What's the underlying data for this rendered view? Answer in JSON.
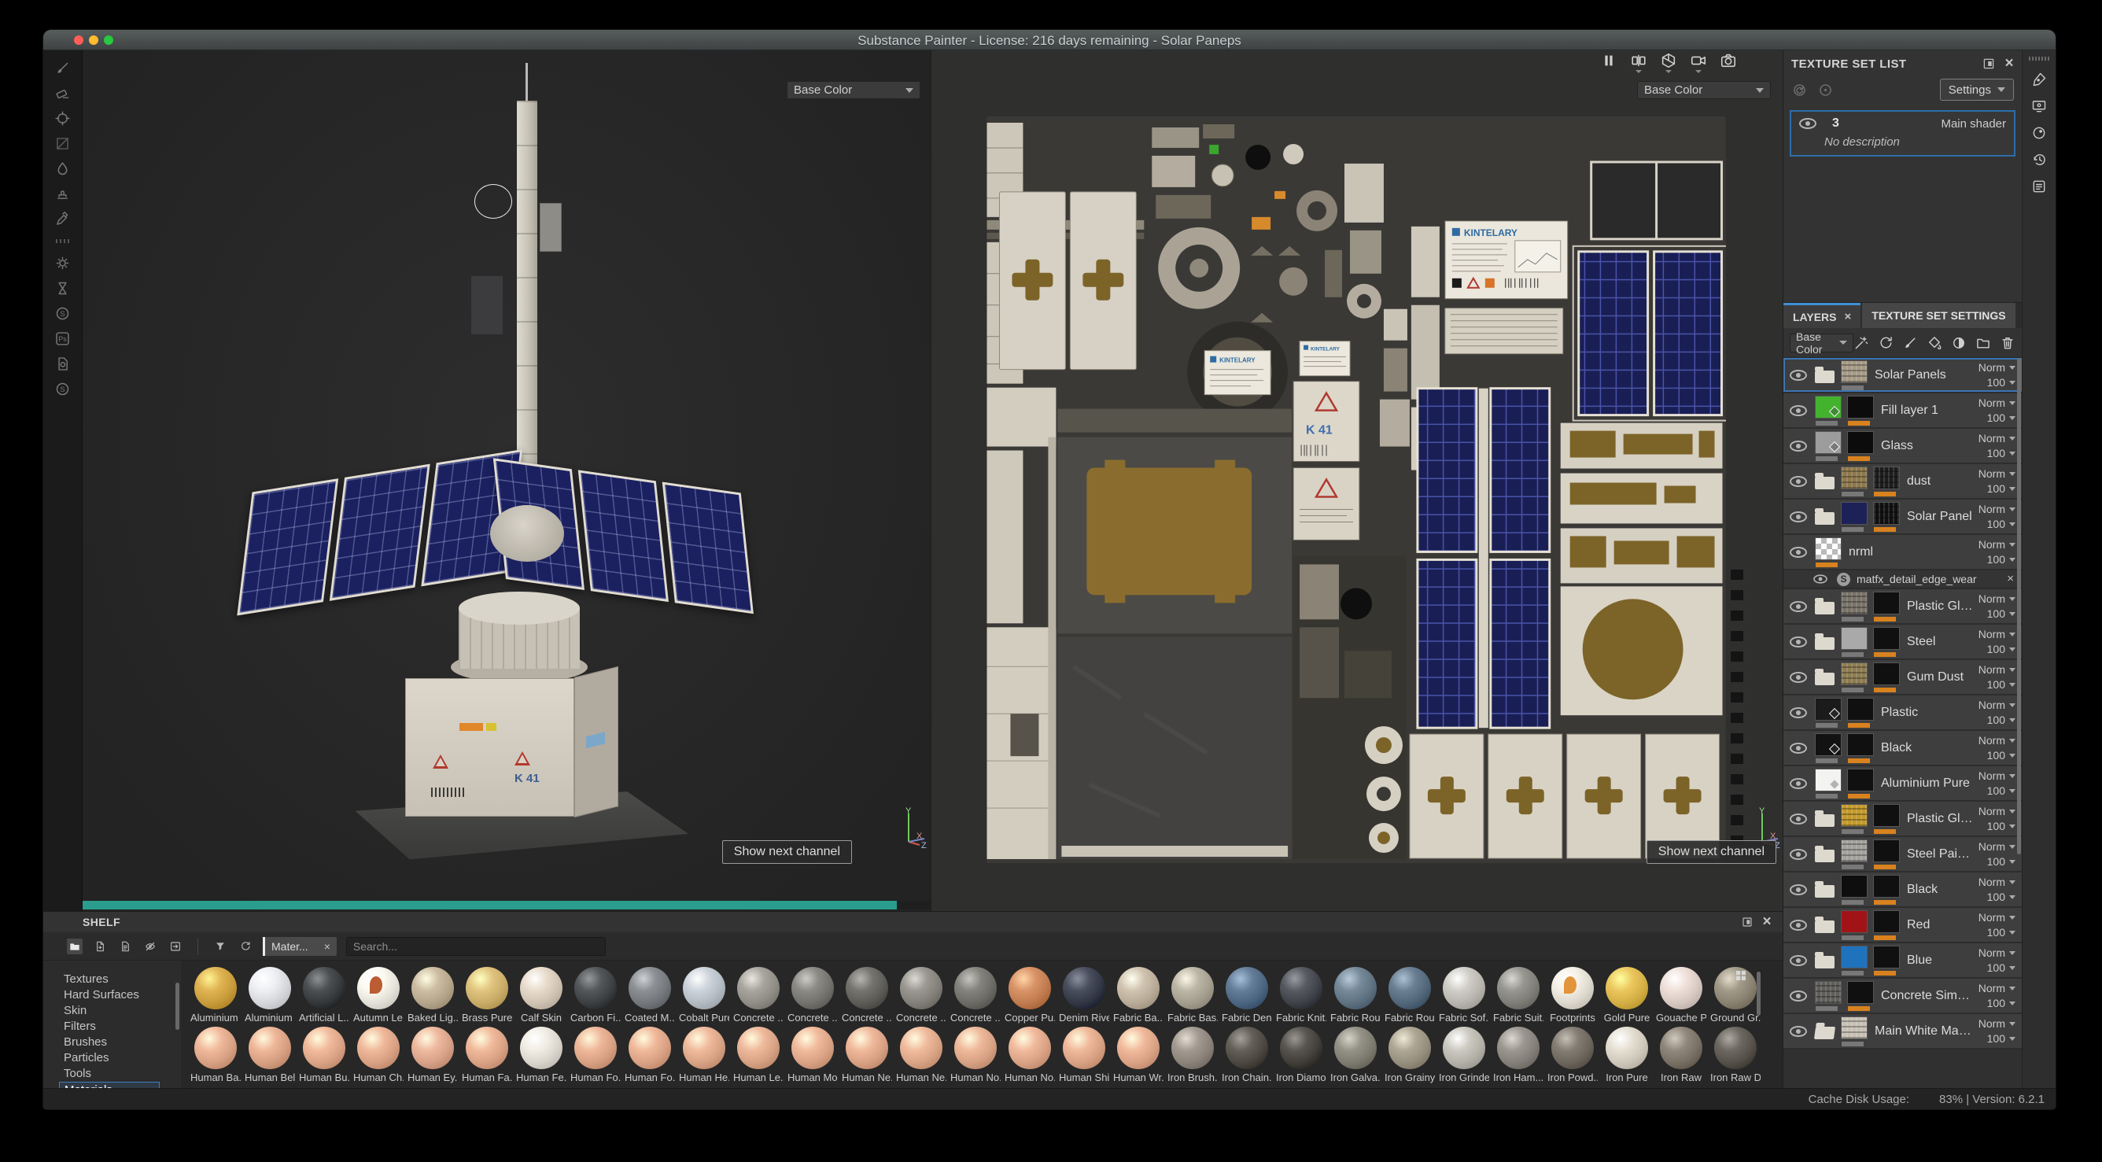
{
  "window": {
    "title": "Substance Painter - License: 216 days remaining - Solar Paneps"
  },
  "top_toolbar": {
    "icons": [
      "pause",
      "view-toggle",
      "geometry",
      "camera-video",
      "camera-photo"
    ]
  },
  "left_toolbar": {
    "icons": [
      "paint-brush",
      "eraser",
      "projection",
      "polygon-fill",
      "smudge",
      "clone-stamp",
      "color-picker",
      "dynamic-gear",
      "hourglass",
      "substance-badge",
      "photoshop",
      "iray",
      "substance-source"
    ]
  },
  "right_strip": {
    "icons": [
      "texture-pen",
      "display-settings",
      "shader-settings",
      "history",
      "log"
    ]
  },
  "viewport3d": {
    "channel": "Base Color",
    "show_next_channel": "Show next channel",
    "axes": [
      "Y",
      "X",
      "Z"
    ],
    "base_label": "K 41"
  },
  "viewport2d": {
    "channel": "Base Color",
    "show_next_channel": "Show next channel",
    "axes": [
      "Y",
      "X",
      "Z"
    ],
    "texture_brand": "KINTELARY",
    "texture_label": "K 41"
  },
  "texture_set_list": {
    "title": "TEXTURE SET LIST",
    "icons": [
      "tsl-sync",
      "tsl-solo"
    ],
    "settings_button": "Settings",
    "item": {
      "name": "3",
      "shader": "Main shader",
      "description": "No description"
    }
  },
  "layers_panel": {
    "tabs": [
      {
        "label": "LAYERS"
      },
      {
        "label": "TEXTURE SET SETTINGS"
      }
    ],
    "channel": "Base Color",
    "toolbar_icons": [
      "add-effect",
      "add-smart-material",
      "add-paint-layer",
      "add-fill-layer",
      "add-smart-mask",
      "add-folder",
      "delete"
    ],
    "layers": [
      {
        "name": "Solar Panels",
        "blend": "Norm",
        "opacity": "100",
        "folder": true,
        "thumb": "tex:#a59a86",
        "mask": null,
        "bar1": "gray",
        "bar2": null,
        "selected": true
      },
      {
        "name": "Fill layer 1",
        "blend": "Norm",
        "opacity": "100",
        "thumb": "fill:#43b32e",
        "mask": "flat:#0c0c0c",
        "bar1": "gray",
        "bar2": "orange"
      },
      {
        "name": "Glass",
        "blend": "Norm",
        "opacity": "100",
        "thumb": "fill:#9c9c9c",
        "mask": "flat:#0c0c0c",
        "bar1": "gray",
        "bar2": "orange"
      },
      {
        "name": "dust",
        "blend": "Norm",
        "opacity": "100",
        "folder": true,
        "thumb": "tex:#8d784c",
        "mask": "tex:#1d1d1d",
        "bar1": "gray",
        "bar2": "orange"
      },
      {
        "name": "Solar Panel",
        "blend": "Norm",
        "opacity": "100",
        "folder": true,
        "thumb": "flat:#1c2158",
        "mask": "tex:#111111",
        "bar1": "gray",
        "bar2": "orange"
      },
      {
        "name": "nrml",
        "blend": "Norm",
        "opacity": "100",
        "thumb": "checker",
        "mask": null,
        "bar1": "orange",
        "bar2": null
      },
      {
        "effect": "matfx_detail_edge_wear"
      },
      {
        "name": "Plastic Glossy Stained",
        "blend": "Norm",
        "opacity": "100",
        "folder": true,
        "thumb": "tex:#787268",
        "mask": "flat:#101010",
        "bar1": "gray",
        "bar2": "orange"
      },
      {
        "name": "Steel",
        "blend": "Norm",
        "opacity": "100",
        "folder": true,
        "thumb": "flat:#a9a9a9",
        "mask": "flat:#101010",
        "bar1": "gray",
        "bar2": "orange"
      },
      {
        "name": "Gum Dust",
        "blend": "Norm",
        "opacity": "100",
        "folder": true,
        "thumb": "tex:#8d7c52",
        "mask": "flat:#101010",
        "bar1": "gray",
        "bar2": "orange"
      },
      {
        "name": "Plastic",
        "blend": "Norm",
        "opacity": "100",
        "thumb": "fill:#1b1b1b",
        "mask": "flat:#101010",
        "bar1": "gray",
        "bar2": "orange"
      },
      {
        "name": "Black",
        "blend": "Norm",
        "opacity": "100",
        "thumb": "fill:#121212",
        "mask": "flat:#101010",
        "bar1": "gray",
        "bar2": "orange"
      },
      {
        "name": "Aluminium Pure",
        "blend": "Norm",
        "opacity": "100",
        "thumb": "fill:#f3f3f1",
        "mask": "flat:#101010",
        "bar1": "gray",
        "bar2": "orange"
      },
      {
        "name": "Plastic Glossy Stained",
        "blend": "Norm",
        "opacity": "100",
        "folder": true,
        "thumb": "tex:#c2992b",
        "mask": "flat:#101010",
        "bar1": "gray",
        "bar2": "orange"
      },
      {
        "name": "Steel Painted Rough D...",
        "blend": "Norm",
        "opacity": "100",
        "folder": true,
        "thumb": "tex:#a3a19c",
        "mask": "flat:#101010",
        "bar1": "gray",
        "bar2": "orange"
      },
      {
        "name": "Black",
        "blend": "Norm",
        "opacity": "100",
        "folder": true,
        "thumb": "flat:#0e0e0e",
        "mask": "flat:#101010",
        "bar1": "gray",
        "bar2": "orange"
      },
      {
        "name": "Red",
        "blend": "Norm",
        "opacity": "100",
        "folder": true,
        "thumb": "flat:#a21317",
        "mask": "flat:#101010",
        "bar1": "gray",
        "bar2": "orange"
      },
      {
        "name": "Blue",
        "blend": "Norm",
        "opacity": "100",
        "folder": true,
        "thumb": "flat:#1f73bd",
        "mask": "flat:#101010",
        "bar1": "gray",
        "bar2": "orange"
      },
      {
        "name": "Concrete Simple",
        "blend": "Norm",
        "opacity": "100",
        "thumb": "tex:#5f5e5a",
        "mask": "flat:#101010",
        "bar1": "gray",
        "bar2": "orange"
      },
      {
        "name": "Main White Material",
        "blend": "Norm",
        "opacity": "100",
        "folderOpen": true,
        "thumb": "tex:#c7c0b4",
        "mask": null,
        "bar1": "gray",
        "bar2": null
      }
    ]
  },
  "shelf": {
    "title": "SHELF",
    "toolbar_icons": [
      "folder-fill",
      "new-resource",
      "import-resources",
      "hidden",
      "export"
    ],
    "filter_icons": [
      "filter",
      "refresh"
    ],
    "tab_label": "Mater...",
    "search_placeholder": "Search...",
    "categories": [
      "Textures",
      "Hard Surfaces",
      "Skin",
      "Filters",
      "Brushes",
      "Particles",
      "Tools",
      "Materials"
    ],
    "selected_category": "Materials",
    "materials_row1": [
      {
        "label": "Aluminium ...",
        "color": "#c79a3a"
      },
      {
        "label": "Aluminium ...",
        "color": "#d4d6da"
      },
      {
        "label": "Artificial L...",
        "color": "#33373a"
      },
      {
        "label": "Autumn Le...",
        "color": "#e3e0d8",
        "accent": "#b44a1e"
      },
      {
        "label": "Baked Lig...",
        "color": "#b4a48a"
      },
      {
        "label": "Brass Pure",
        "color": "#c8ab66"
      },
      {
        "label": "Calf Skin",
        "color": "#cfc2b2"
      },
      {
        "label": "Carbon Fi...",
        "color": "#3c3f42"
      },
      {
        "label": "Coated M...",
        "color": "#73777b"
      },
      {
        "label": "Cobalt Pure",
        "color": "#b3bac1"
      },
      {
        "label": "Concrete ...",
        "color": "#8f8c85"
      },
      {
        "label": "Concrete ...",
        "color": "#73716b"
      },
      {
        "label": "Concrete ...",
        "color": "#5d5b56"
      },
      {
        "label": "Concrete ...",
        "color": "#817f78"
      },
      {
        "label": "Concrete ...",
        "color": "#6c6a64"
      },
      {
        "label": "Copper Pu...",
        "color": "#bf7a4e"
      },
      {
        "label": "Denim Rivet",
        "color": "#303644"
      },
      {
        "label": "Fabric Ba...",
        "color": "#b7ab97"
      },
      {
        "label": "Fabric Bas...",
        "color": "#a39d8e"
      },
      {
        "label": "Fabric Den...",
        "color": "#4b647f"
      },
      {
        "label": "Fabric Knit...",
        "color": "#3e4147"
      },
      {
        "label": "Fabric Rou...",
        "color": "#5e7181"
      },
      {
        "label": "Fabric Rou...",
        "color": "#52667a"
      },
      {
        "label": "Fabric Sof...",
        "color": "#b6b4ad"
      },
      {
        "label": "Fabric Suit...",
        "color": "#7f7d77"
      },
      {
        "label": "Footprints",
        "color": "#dcd7cd",
        "accent": "#e08a28"
      },
      {
        "label": "Gold Pure",
        "color": "#d2ae45"
      },
      {
        "label": "Gouache P...",
        "color": "#d6c7c0"
      },
      {
        "label": "Ground Gr...",
        "color": "#88816f"
      }
    ],
    "materials_row2": [
      {
        "label": "Human Ba...",
        "color": "#d8a083"
      },
      {
        "label": "Human Bel...",
        "color": "#d69e81"
      },
      {
        "label": "Human Bu...",
        "color": "#d9a284"
      },
      {
        "label": "Human Ch...",
        "color": "#d7a083"
      },
      {
        "label": "Human Ey...",
        "color": "#d5a086"
      },
      {
        "label": "Human Fa...",
        "color": "#d8a184"
      },
      {
        "label": "Human Fe...",
        "color": "#d8d4cb"
      },
      {
        "label": "Human Fo...",
        "color": "#d69f82"
      },
      {
        "label": "Human Fo...",
        "color": "#d8a083"
      },
      {
        "label": "Human He...",
        "color": "#d7a184"
      },
      {
        "label": "Human Le...",
        "color": "#d6a083"
      },
      {
        "label": "Human Mo...",
        "color": "#d8a184"
      },
      {
        "label": "Human Ne...",
        "color": "#d7a083"
      },
      {
        "label": "Human Ne...",
        "color": "#d8a285"
      },
      {
        "label": "Human No...",
        "color": "#d6a083"
      },
      {
        "label": "Human No...",
        "color": "#d8a184"
      },
      {
        "label": "Human Shi...",
        "color": "#d7a083"
      },
      {
        "label": "Human Wr...",
        "color": "#d8a184"
      },
      {
        "label": "Iron Brush...",
        "color": "#8a8279"
      },
      {
        "label": "Iron Chain...",
        "color": "#4b4740"
      },
      {
        "label": "Iron Diamo...",
        "color": "#403d38"
      },
      {
        "label": "Iron Galva...",
        "color": "#7c796f"
      },
      {
        "label": "Iron Grainy",
        "color": "#968e7d"
      },
      {
        "label": "Iron Grinded",
        "color": "#b3b0a8"
      },
      {
        "label": "Iron Ham...",
        "color": "#837f78"
      },
      {
        "label": "Iron Powd...",
        "color": "#6a645b"
      },
      {
        "label": "Iron Pure",
        "color": "#cdc7ba"
      },
      {
        "label": "Iron Raw",
        "color": "#786f64"
      },
      {
        "label": "Iron Raw D...",
        "color": "#544f48"
      }
    ]
  },
  "status_bar": {
    "label": "Cache Disk Usage:",
    "value": "83% | Version: 6.2.1"
  }
}
